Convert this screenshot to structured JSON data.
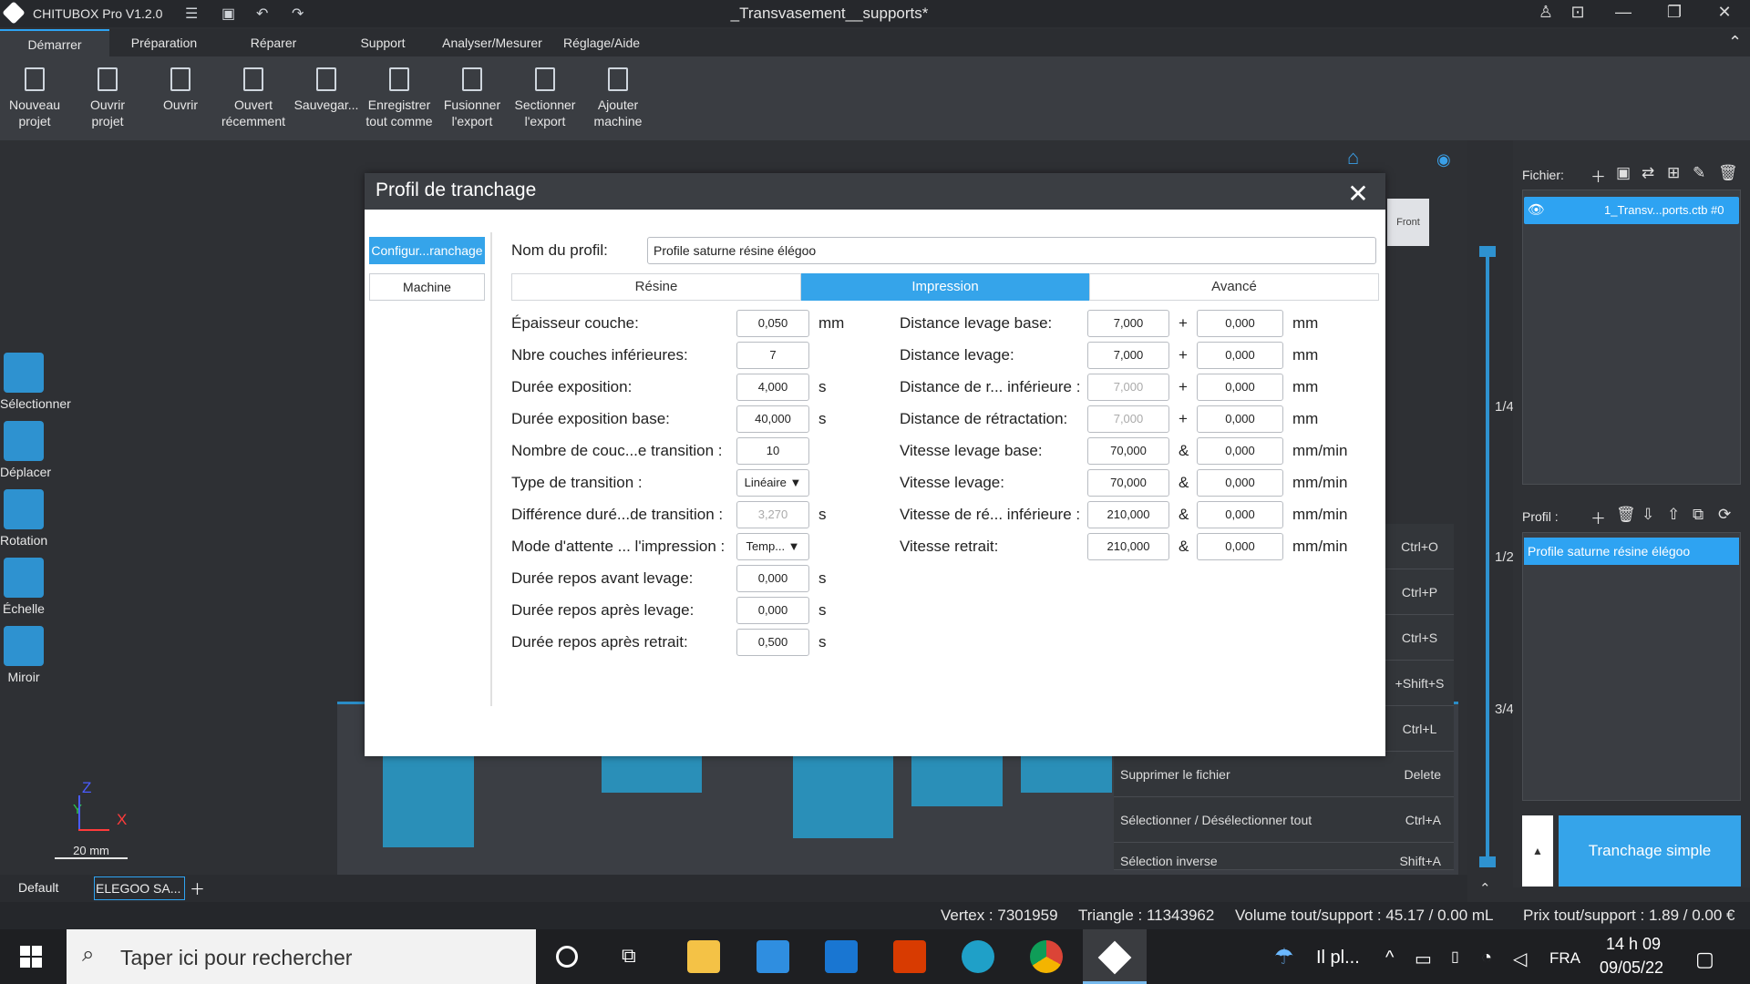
{
  "titlebar": {
    "app_name": "CHITUBOX Pro V1.2.0",
    "doc_title": "_Transvasement__supports*"
  },
  "menu_tabs": [
    "Démarrer",
    "Préparation",
    "Réparer",
    "Support",
    "Analyser/Mesurer",
    "Réglage/Aide"
  ],
  "ribbon": [
    {
      "l1": "Nouveau",
      "l2": "projet",
      "icon": "new-project-icon"
    },
    {
      "l1": "Ouvrir",
      "l2": "projet",
      "icon": "open-project-icon"
    },
    {
      "l1": "Ouvrir",
      "l2": "",
      "icon": "open-icon"
    },
    {
      "l1": "Ouvert",
      "l2": "récemment",
      "icon": "recent-icon"
    },
    {
      "l1": "Sauvegar...",
      "l2": "",
      "icon": "save-icon"
    },
    {
      "l1": "Enregistrer",
      "l2": "tout comme",
      "icon": "save-all-icon"
    },
    {
      "l1": "Fusionner",
      "l2": "l'export",
      "icon": "merge-export-icon"
    },
    {
      "l1": "Sectionner",
      "l2": "l'export",
      "icon": "split-export-icon"
    },
    {
      "l1": "Ajouter",
      "l2": "machine",
      "icon": "add-machine-icon"
    }
  ],
  "tools": [
    "Sélectionner",
    "Déplacer",
    "Rotation",
    "Échelle",
    "Miroir"
  ],
  "axes": {
    "z": "Z",
    "y": "Y",
    "x": "X",
    "scale": "20 mm"
  },
  "view_cube": {
    "front": "Front"
  },
  "slider_marks": [
    "1/4",
    "1/2",
    "3/4"
  ],
  "dialog": {
    "title": "Profil de tranchage",
    "nav": [
      "Configur...ranchage",
      "Machine"
    ],
    "profile_label": "Nom du profil:",
    "profile_name": "Profile  saturne résine élégoo",
    "tabs": [
      "Résine",
      "Impression",
      "Avancé"
    ],
    "left_rows": [
      {
        "label": "Épaisseur couche:",
        "value": "0,050",
        "unit": "mm"
      },
      {
        "label": "Nbre couches inférieures:",
        "value": "7",
        "unit": ""
      },
      {
        "label": "Durée exposition:",
        "value": "4,000",
        "unit": "s"
      },
      {
        "label": "Durée exposition base:",
        "value": "40,000",
        "unit": "s"
      },
      {
        "label": "Nombre de couc...e transition :",
        "value": "10",
        "unit": ""
      },
      {
        "label": "Type de transition :",
        "value": "Linéaire",
        "unit": ""
      },
      {
        "label": "Différence duré...de transition :",
        "value": "3,270",
        "unit": "s"
      },
      {
        "label": "Mode d'attente ... l'impression :",
        "value": "Temp...",
        "unit": ""
      },
      {
        "label": "Durée repos avant levage:",
        "value": "0,000",
        "unit": "s"
      },
      {
        "label": "Durée repos après levage:",
        "value": "0,000",
        "unit": "s"
      },
      {
        "label": "Durée repos après retrait:",
        "value": "0,500",
        "unit": "s"
      }
    ],
    "right_rows": [
      {
        "label": "Distance levage base:",
        "v1": "7,000",
        "op": "+",
        "v2": "0,000",
        "unit": "mm"
      },
      {
        "label": "Distance levage:",
        "v1": "7,000",
        "op": "+",
        "v2": "0,000",
        "unit": "mm"
      },
      {
        "label": "Distance de r... inférieure :",
        "v1": "7,000",
        "op": "+",
        "v2": "0,000",
        "unit": "mm"
      },
      {
        "label": "Distance de rétractation:",
        "v1": "7,000",
        "op": "+",
        "v2": "0,000",
        "unit": "mm"
      },
      {
        "label": "Vitesse levage base:",
        "v1": "70,000",
        "op": "&",
        "v2": "0,000",
        "unit": "mm/min"
      },
      {
        "label": "Vitesse levage:",
        "v1": "70,000",
        "op": "&",
        "v2": "0,000",
        "unit": "mm/min"
      },
      {
        "label": "Vitesse de ré... inférieure :",
        "v1": "210,000",
        "op": "&",
        "v2": "0,000",
        "unit": "mm/min"
      },
      {
        "label": "Vitesse retrait:",
        "v1": "210,000",
        "op": "&",
        "v2": "0,000",
        "unit": "mm/min"
      }
    ]
  },
  "context_menu": {
    "shortcuts": [
      "Ctrl+O",
      "Ctrl+P",
      "Ctrl+S",
      "+Shift+S",
      "Ctrl+L"
    ],
    "rows": [
      {
        "label": "Supprimer le fichier",
        "shortcut": "Delete"
      },
      {
        "label": "Sélectionner / Désélectionner tout",
        "shortcut": "Ctrl+A"
      },
      {
        "label": "Sélection inverse",
        "shortcut": "Shift+A"
      }
    ]
  },
  "right_panel": {
    "file_label": "Fichier:",
    "file_item": "1_Transv...ports.ctb #0",
    "profile_label": "Profil :",
    "profile_item": "Profile  saturne résine élégoo",
    "slice_button": "Tranchage simple"
  },
  "bottom_tabs": {
    "default": "Default",
    "machine": "ELEGOO SA..."
  },
  "status": {
    "vertex": "Vertex : 7301959",
    "triangle": "Triangle : 11343962",
    "volume": "Volume tout/support : 45.17 / 0.00 mL",
    "price": "Prix tout/support : 1.89 / 0.00 €"
  },
  "taskbar": {
    "search": "Taper ici pour rechercher",
    "weather": "Il pl...",
    "lang": "FRA",
    "time": "14 h 09",
    "date": "09/05/22"
  },
  "colors": {
    "accent": "#35a4ea",
    "model": "#2a8fb8"
  }
}
